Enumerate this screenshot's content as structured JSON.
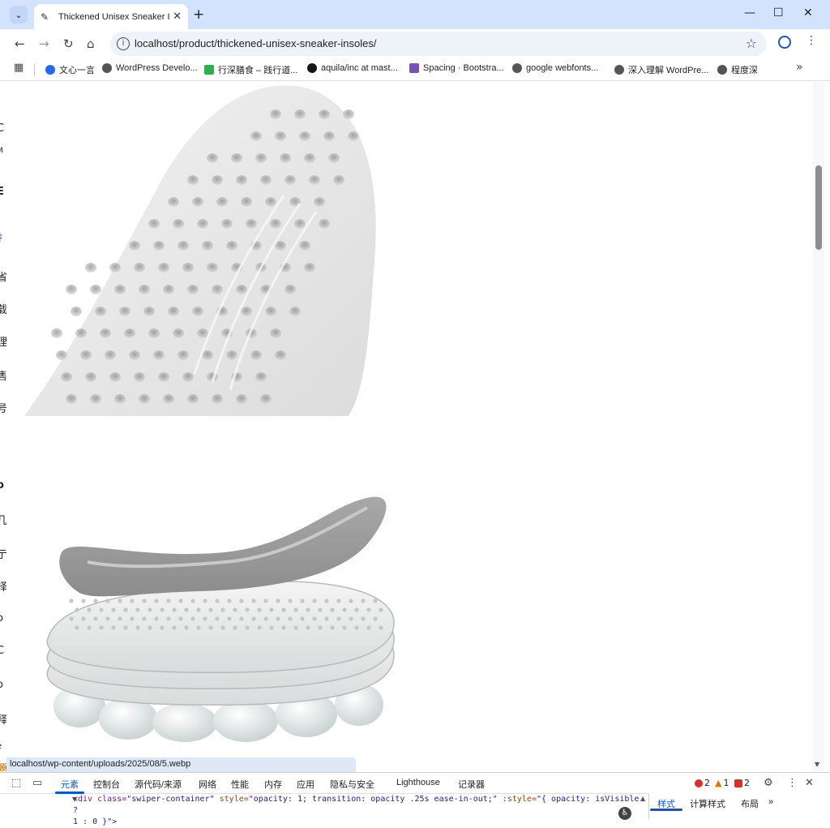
{
  "browser": {
    "tab_title": "Thickened Unisex Sneaker Inso",
    "url": "localhost/product/thickened-unisex-sneaker-insoles/",
    "status_url": "localhost/wp-content/uploads/2025/08/5.webp"
  },
  "bookmarks": [
    {
      "label": "文心一言",
      "color": "#2468f2"
    },
    {
      "label": "WordPress Develo...",
      "color": "#555555"
    },
    {
      "label": "行深膳食 – 践行道...",
      "color": "#2bb24c"
    },
    {
      "label": "aquila/inc at mast...",
      "color": "#181717"
    },
    {
      "label": "Spacing · Bootstra...",
      "color": "#7952b3"
    },
    {
      "label": "google webfonts...",
      "color": "#555555"
    },
    {
      "label": "深入理解 WordPre...",
      "color": "#555555"
    },
    {
      "label": "程度深",
      "color": "#555555"
    }
  ],
  "left_strip_chars": [
    "C",
    "M",
    "E",
    "扌",
    "省",
    "载",
    "理",
    "售",
    "号",
    "o",
    "几",
    "亍",
    "择",
    "o",
    "C",
    "o",
    "释",
    "e",
    "源"
  ],
  "devtools": {
    "tabs": [
      "元素",
      "控制台",
      "源代码/来源",
      "网络",
      "性能",
      "内存",
      "应用",
      "隐私与安全",
      "Lighthouse",
      "记录器"
    ],
    "errors": "2",
    "warnings": "1",
    "issues": "2",
    "code_line1_tag": "<div class=",
    "code_line1_class": "\"swiper-container\"",
    "code_line1_style_attr": " style=",
    "code_line1_style_val": "\"opacity: 1; transition: opacity .25s ease-in-out;\"",
    "code_line1_bind_attr": " :style=",
    "code_line1_bind_val": "\"{ opacity: isVisible ?",
    "code_line2": "1 : 0 }\">",
    "right_tabs": [
      "样式",
      "计算样式",
      "布局"
    ]
  }
}
